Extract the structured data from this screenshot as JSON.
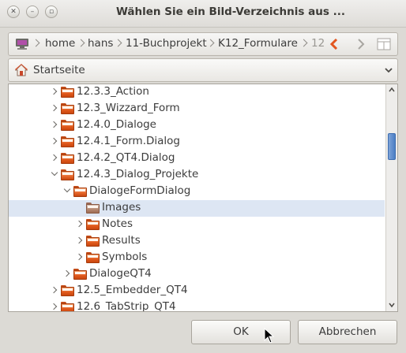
{
  "window": {
    "title": "Wählen Sie ein Bild-Verzeichnis aus ..."
  },
  "breadcrumb": {
    "items": [
      "home",
      "hans",
      "11-Buchprojekt",
      "K12_Formulare",
      "12"
    ],
    "icons": [
      "computer-icon",
      "back-arrow-icon",
      "forward-arrow-icon",
      "pane-icon"
    ],
    "accent": "#e2561f"
  },
  "places": {
    "selected": "Startseite",
    "icon": "home-icon"
  },
  "tree": {
    "rows": [
      {
        "label": "12.3.3_Action",
        "state": "collapsed",
        "selected": false
      },
      {
        "label": "12.3_Wizzard_Form",
        "state": "collapsed",
        "selected": false
      },
      {
        "label": "12.4.0_Dialoge",
        "state": "collapsed",
        "selected": false
      },
      {
        "label": "12.4.1_Form.Dialog",
        "state": "collapsed",
        "selected": false
      },
      {
        "label": "12.4.2_QT4.Dialog",
        "state": "collapsed",
        "selected": false
      },
      {
        "label": "12.4.3_Dialog_Projekte",
        "state": "expanded",
        "selected": false
      },
      {
        "label": "DialogeFormDialog",
        "state": "expanded",
        "selected": false
      },
      {
        "label": "Images",
        "state": "leaf",
        "selected": true
      },
      {
        "label": "Notes",
        "state": "collapsed",
        "selected": false
      },
      {
        "label": "Results",
        "state": "collapsed",
        "selected": false
      },
      {
        "label": "Symbols",
        "state": "collapsed",
        "selected": false
      },
      {
        "label": "DialogeQT4",
        "state": "collapsed",
        "selected": false
      },
      {
        "label": "12.5_Embedder_QT4",
        "state": "collapsed",
        "selected": false
      },
      {
        "label": "12.6_TabStrip_QT4",
        "state": "collapsed",
        "selected": false
      }
    ],
    "selection_color": "#dde6f3",
    "folder_color": "#e0581c"
  },
  "buttons": {
    "ok": "OK",
    "cancel": "Abbrechen"
  }
}
